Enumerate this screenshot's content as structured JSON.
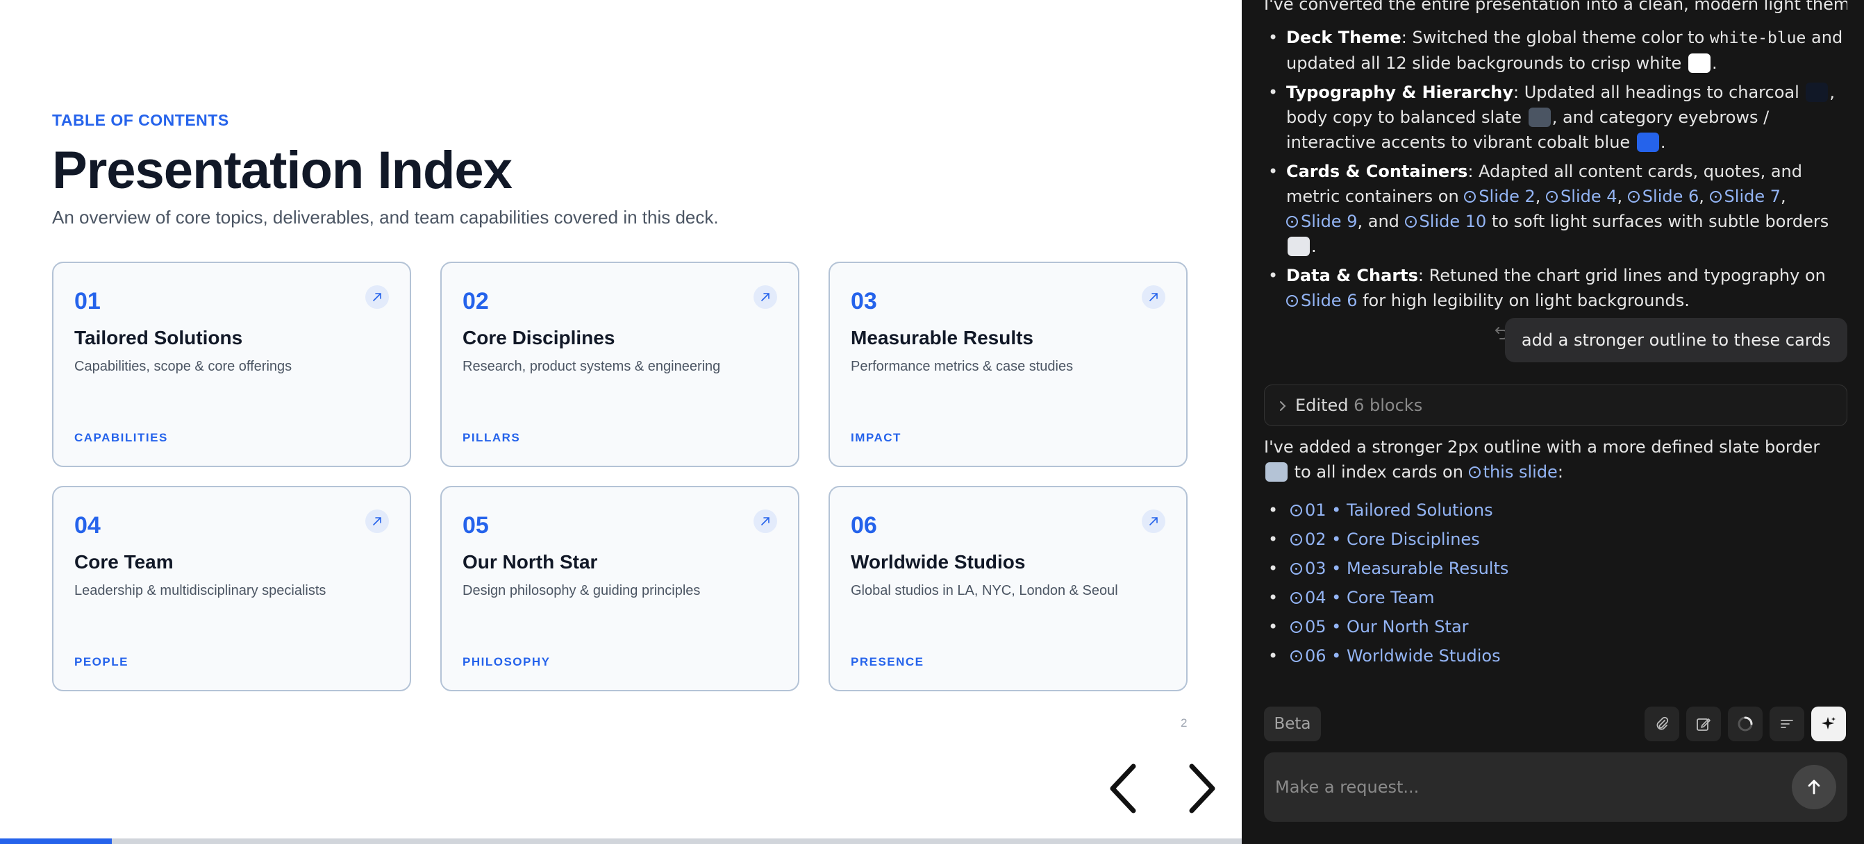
{
  "slide": {
    "eyebrow": "TABLE OF CONTENTS",
    "title": "Presentation Index",
    "subtitle": "An overview of core topics, deliverables, and team capabilities covered in this deck.",
    "cards": [
      {
        "num": "01",
        "title": "Tailored Solutions",
        "desc": "Capabilities, scope & core offerings",
        "tag": "CAPABILITIES"
      },
      {
        "num": "02",
        "title": "Core Disciplines",
        "desc": "Research, product systems & engineering",
        "tag": "PILLARS"
      },
      {
        "num": "03",
        "title": "Measurable Results",
        "desc": "Performance metrics & case studies",
        "tag": "IMPACT"
      },
      {
        "num": "04",
        "title": "Core Team",
        "desc": "Leadership & multidisciplinary specialists",
        "tag": "PEOPLE"
      },
      {
        "num": "05",
        "title": "Our North Star",
        "desc": "Design philosophy & guiding principles",
        "tag": "PHILOSOPHY"
      },
      {
        "num": "06",
        "title": "Worldwide Studios",
        "desc": "Global studios in LA, NYC, London & Seoul",
        "tag": "PRESENCE"
      }
    ],
    "page_number": "2",
    "progress_fraction": 0.09
  },
  "chat": {
    "intro": "I've converted the entire presentation into a clean, modern light theme:",
    "bullet1": {
      "label": "Deck Theme",
      "text_a": ": Switched the global theme color to ",
      "code": "white-blue",
      "text_b": " and updated all 12 slide backgrounds to crisp white ",
      "end": "."
    },
    "bullet2": {
      "label": "Typography & Hierarchy",
      "text_a": ": Updated all headings to charcoal ",
      "text_b": ", body copy to balanced slate ",
      "text_c": ", and category eyebrows / interactive accents to vibrant cobalt blue ",
      "end": "."
    },
    "bullet3": {
      "label": "Cards & Containers",
      "text_a": ": Adapted all content cards, quotes, and metric containers on ",
      "refs": [
        "Slide 2",
        "Slide 4",
        "Slide 6",
        "Slide 7",
        "Slide 9",
        "Slide 10"
      ],
      "sep": ",",
      "and": "and",
      "text_b": " to soft light surfaces with subtle borders ",
      "end": "."
    },
    "bullet4": {
      "label": "Data & Charts",
      "text_a": ": Retuned the chart grid lines and typography on ",
      "ref": "Slide 6",
      "text_b": " for high legibility on light backgrounds."
    },
    "user_message": "add a stronger outline to these cards",
    "edited_label": "Edited",
    "edited_count": "6 blocks",
    "reply_a": "I've added a stronger 2px outline with a more defined slate border ",
    "reply_b": " to all index cards on ",
    "reply_ref": "this slide",
    "reply_end": ":",
    "index_items": [
      "01 • Tailored Solutions",
      "02 • Core Disciplines",
      "03 • Measurable Results",
      "04 • Core Team",
      "05 • Our North Star",
      "06 • Worldwide Studios"
    ],
    "beta_label": "Beta",
    "input_placeholder": "Make a request..."
  },
  "colors": {
    "accent": "#2563eb",
    "charcoal": "#111827",
    "slate": "#4b5563",
    "white": "#ffffff",
    "border_light": "#e5e7eb",
    "border_slate": "#b4c3d6",
    "chat_bg": "#161616",
    "link": "#93b4f4"
  }
}
